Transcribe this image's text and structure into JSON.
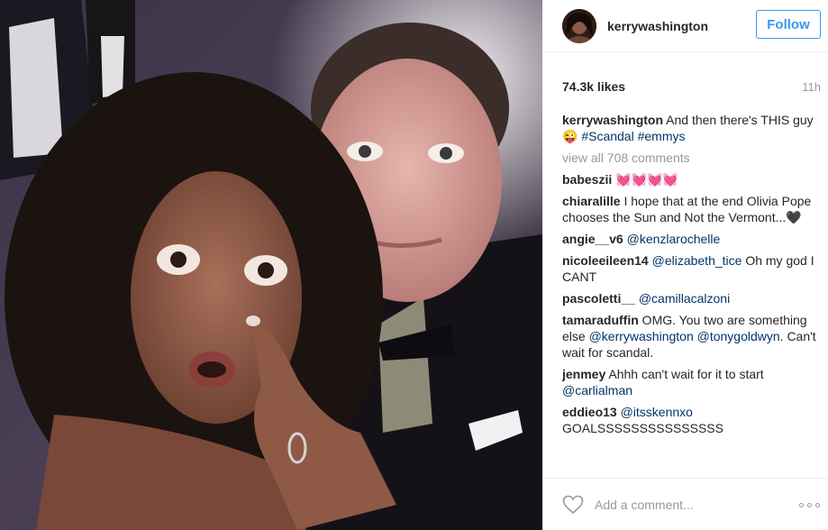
{
  "post": {
    "username": "kerrywashington",
    "follow_label": "Follow",
    "likes": "74.3k likes",
    "time": "11h"
  },
  "caption": {
    "user": "kerrywashington",
    "text": " And then there's THIS guy 😜 ",
    "tags": [
      "#Scandal",
      "#emmys"
    ]
  },
  "view_all": "view all 708 comments",
  "comments": [
    {
      "user": "babeszii",
      "parts": [
        {
          "t": "text",
          "v": " 💓💓💓💓"
        }
      ]
    },
    {
      "user": "chiaralille",
      "parts": [
        {
          "t": "text",
          "v": " I hope that at the end Olivia Pope chooses the Sun and Not the Vermont...🖤"
        }
      ]
    },
    {
      "user": "angie__v6",
      "parts": [
        {
          "t": "text",
          "v": " "
        },
        {
          "t": "mention",
          "v": "@kenzlarochelle"
        }
      ]
    },
    {
      "user": "nicoleeileen14",
      "parts": [
        {
          "t": "text",
          "v": " "
        },
        {
          "t": "mention",
          "v": "@elizabeth_tice"
        },
        {
          "t": "text",
          "v": " Oh my god I CANT"
        }
      ]
    },
    {
      "user": "pascoletti__",
      "parts": [
        {
          "t": "text",
          "v": " "
        },
        {
          "t": "mention",
          "v": "@camillacalzoni"
        }
      ]
    },
    {
      "user": "tamaraduffin",
      "parts": [
        {
          "t": "text",
          "v": " OMG. You two are something else "
        },
        {
          "t": "mention",
          "v": "@kerrywashington"
        },
        {
          "t": "text",
          "v": " "
        },
        {
          "t": "mention",
          "v": "@tonygoldwyn"
        },
        {
          "t": "text",
          "v": ". Can't wait for scandal."
        }
      ]
    },
    {
      "user": "jenmey",
      "parts": [
        {
          "t": "text",
          "v": " Ahhh can't wait for it to start "
        },
        {
          "t": "mention",
          "v": "@carlialman"
        }
      ]
    },
    {
      "user": "eddieo13",
      "parts": [
        {
          "t": "text",
          "v": " "
        },
        {
          "t": "mention",
          "v": "@itsskennxo"
        },
        {
          "t": "text",
          "v": " GOALSSSSSSSSSSSSSSS"
        }
      ]
    }
  ],
  "add_comment_placeholder": "Add a comment...",
  "icons": {
    "like": "heart-outline-icon",
    "more": "more-options-icon"
  },
  "colors": {
    "accent": "#3897f0",
    "mention": "#003569",
    "muted": "#999999"
  }
}
